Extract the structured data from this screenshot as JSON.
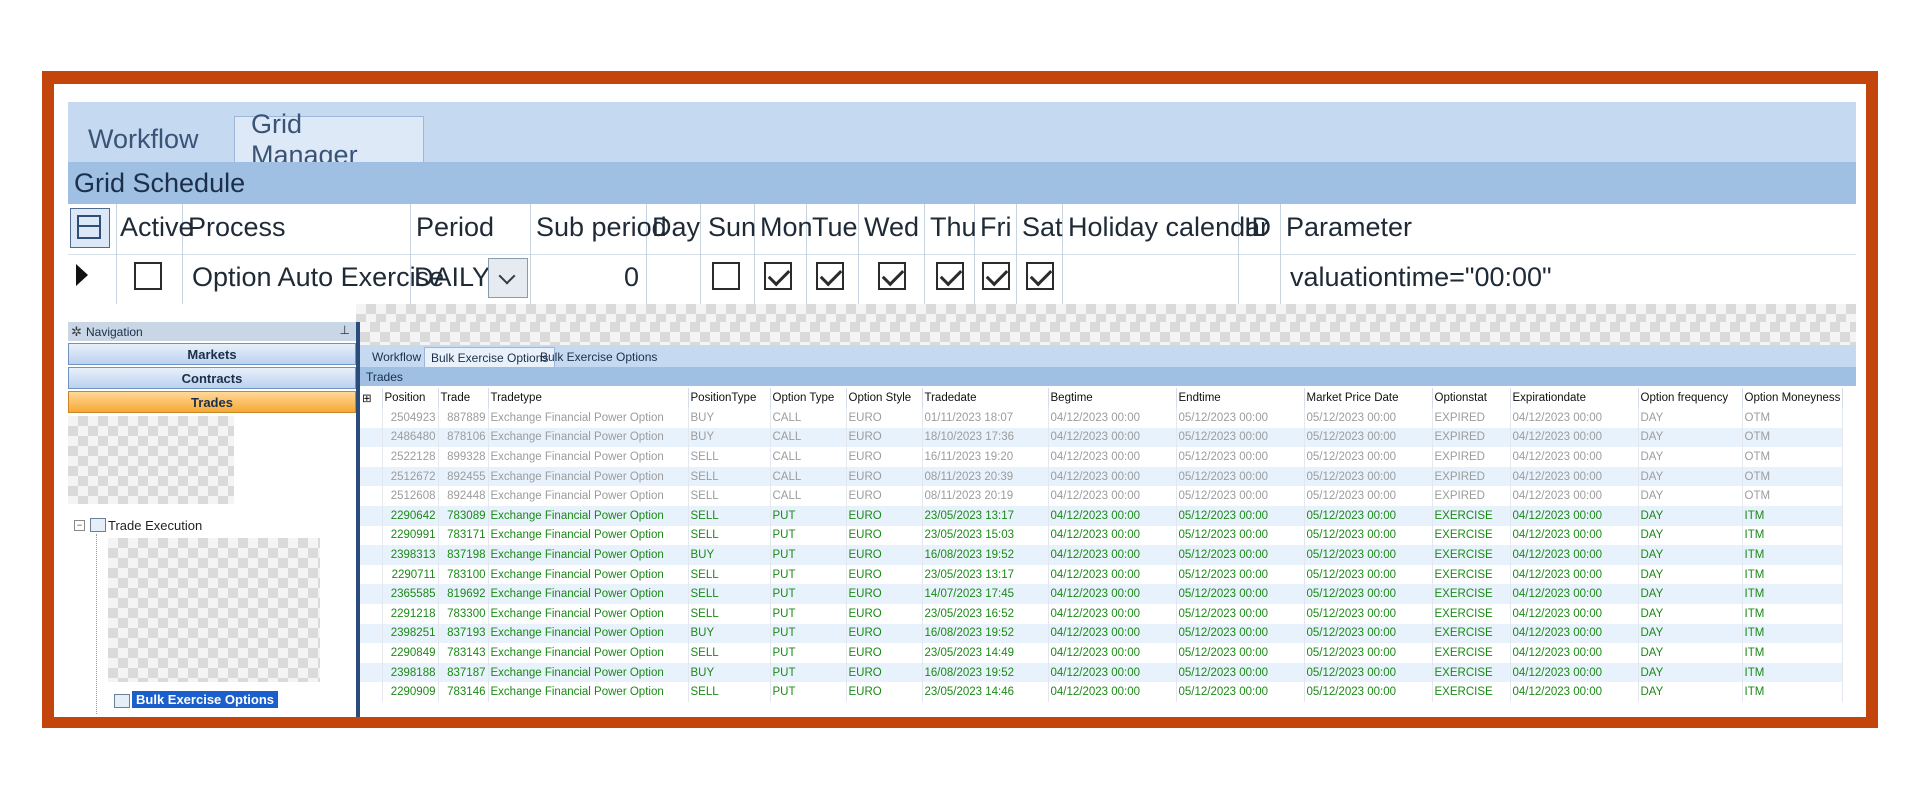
{
  "top_tabs": [
    "Workflow",
    "Grid Manager"
  ],
  "section_title": "Grid Schedule",
  "schedule": {
    "columns": [
      "Active",
      "Process",
      "Period",
      "Sub period",
      "Day",
      "Sun",
      "Mon",
      "Tue",
      "Wed",
      "Thu",
      "Fri",
      "Sat",
      "Holiday calendar",
      "ID",
      "Parameter"
    ],
    "row": {
      "active": false,
      "process": "Option Auto Exercise",
      "period": "DAILY",
      "sub_period": "0",
      "day": "",
      "sun": false,
      "mon": true,
      "tue": true,
      "wed": true,
      "thu": true,
      "fri": true,
      "sat": true,
      "holiday_calendar": "",
      "id": "",
      "parameter": "valuationtime=\"00:00\""
    }
  },
  "navigation": {
    "title": "Navigation",
    "buttons": [
      "Markets",
      "Contracts",
      "Trades"
    ],
    "tree_node": "Trade Execution",
    "selected_node": "Bulk Exercise Options"
  },
  "trades_tabs": [
    "Workflow",
    "Bulk Exercise Options",
    "Bulk Exercise Options"
  ],
  "trades_title": "Trades",
  "trade_columns": [
    "Position",
    "Trade",
    "Tradetype",
    "PositionType",
    "Option Type",
    "Option Style",
    "Tradedate",
    "Begtime",
    "Endtime",
    "Market Price Date",
    "Optionstat",
    "Expirationdate",
    "Option frequency",
    "Option Moneyness"
  ],
  "trades": [
    {
      "status_group": "expired",
      "cells": [
        "2504923",
        "887889",
        "Exchange Financial Power Option",
        "BUY",
        "CALL",
        "EURO",
        "01/11/2023 18:07",
        "04/12/2023 00:00",
        "05/12/2023 00:00",
        "05/12/2023 00:00",
        "EXPIRED",
        "04/12/2023 00:00",
        "DAY",
        "OTM"
      ]
    },
    {
      "status_group": "expired",
      "cells": [
        "2486480",
        "878106",
        "Exchange Financial Power Option",
        "BUY",
        "CALL",
        "EURO",
        "18/10/2023 17:36",
        "04/12/2023 00:00",
        "05/12/2023 00:00",
        "05/12/2023 00:00",
        "EXPIRED",
        "04/12/2023 00:00",
        "DAY",
        "OTM"
      ]
    },
    {
      "status_group": "expired",
      "cells": [
        "2522128",
        "899328",
        "Exchange Financial Power Option",
        "SELL",
        "CALL",
        "EURO",
        "16/11/2023 19:20",
        "04/12/2023 00:00",
        "05/12/2023 00:00",
        "05/12/2023 00:00",
        "EXPIRED",
        "04/12/2023 00:00",
        "DAY",
        "OTM"
      ]
    },
    {
      "status_group": "expired",
      "cells": [
        "2512672",
        "892455",
        "Exchange Financial Power Option",
        "SELL",
        "CALL",
        "EURO",
        "08/11/2023 20:39",
        "04/12/2023 00:00",
        "05/12/2023 00:00",
        "05/12/2023 00:00",
        "EXPIRED",
        "04/12/2023 00:00",
        "DAY",
        "OTM"
      ]
    },
    {
      "status_group": "expired",
      "cells": [
        "2512608",
        "892448",
        "Exchange Financial Power Option",
        "SELL",
        "CALL",
        "EURO",
        "08/11/2023 20:19",
        "04/12/2023 00:00",
        "05/12/2023 00:00",
        "05/12/2023 00:00",
        "EXPIRED",
        "04/12/2023 00:00",
        "DAY",
        "OTM"
      ]
    },
    {
      "status_group": "exercise",
      "cells": [
        "2290642",
        "783089",
        "Exchange Financial Power Option",
        "SELL",
        "PUT",
        "EURO",
        "23/05/2023 13:17",
        "04/12/2023 00:00",
        "05/12/2023 00:00",
        "05/12/2023 00:00",
        "EXERCISE",
        "04/12/2023 00:00",
        "DAY",
        "ITM"
      ]
    },
    {
      "status_group": "exercise",
      "cells": [
        "2290991",
        "783171",
        "Exchange Financial Power Option",
        "SELL",
        "PUT",
        "EURO",
        "23/05/2023 15:03",
        "04/12/2023 00:00",
        "05/12/2023 00:00",
        "05/12/2023 00:00",
        "EXERCISE",
        "04/12/2023 00:00",
        "DAY",
        "ITM"
      ]
    },
    {
      "status_group": "exercise",
      "cells": [
        "2398313",
        "837198",
        "Exchange Financial Power Option",
        "BUY",
        "PUT",
        "EURO",
        "16/08/2023 19:52",
        "04/12/2023 00:00",
        "05/12/2023 00:00",
        "05/12/2023 00:00",
        "EXERCISE",
        "04/12/2023 00:00",
        "DAY",
        "ITM"
      ]
    },
    {
      "status_group": "exercise",
      "cells": [
        "2290711",
        "783100",
        "Exchange Financial Power Option",
        "SELL",
        "PUT",
        "EURO",
        "23/05/2023 13:17",
        "04/12/2023 00:00",
        "05/12/2023 00:00",
        "05/12/2023 00:00",
        "EXERCISE",
        "04/12/2023 00:00",
        "DAY",
        "ITM"
      ]
    },
    {
      "status_group": "exercise",
      "cells": [
        "2365585",
        "819692",
        "Exchange Financial Power Option",
        "SELL",
        "PUT",
        "EURO",
        "14/07/2023 17:45",
        "04/12/2023 00:00",
        "05/12/2023 00:00",
        "05/12/2023 00:00",
        "EXERCISE",
        "04/12/2023 00:00",
        "DAY",
        "ITM"
      ]
    },
    {
      "status_group": "exercise",
      "cells": [
        "2291218",
        "783300",
        "Exchange Financial Power Option",
        "SELL",
        "PUT",
        "EURO",
        "23/05/2023 16:52",
        "04/12/2023 00:00",
        "05/12/2023 00:00",
        "05/12/2023 00:00",
        "EXERCISE",
        "04/12/2023 00:00",
        "DAY",
        "ITM"
      ]
    },
    {
      "status_group": "exercise",
      "cells": [
        "2398251",
        "837193",
        "Exchange Financial Power Option",
        "BUY",
        "PUT",
        "EURO",
        "16/08/2023 19:52",
        "04/12/2023 00:00",
        "05/12/2023 00:00",
        "05/12/2023 00:00",
        "EXERCISE",
        "04/12/2023 00:00",
        "DAY",
        "ITM"
      ]
    },
    {
      "status_group": "exercise",
      "cells": [
        "2290849",
        "783143",
        "Exchange Financial Power Option",
        "SELL",
        "PUT",
        "EURO",
        "23/05/2023 14:49",
        "04/12/2023 00:00",
        "05/12/2023 00:00",
        "05/12/2023 00:00",
        "EXERCISE",
        "04/12/2023 00:00",
        "DAY",
        "ITM"
      ]
    },
    {
      "status_group": "exercise",
      "cells": [
        "2398188",
        "837187",
        "Exchange Financial Power Option",
        "BUY",
        "PUT",
        "EURO",
        "16/08/2023 19:52",
        "04/12/2023 00:00",
        "05/12/2023 00:00",
        "05/12/2023 00:00",
        "EXERCISE",
        "04/12/2023 00:00",
        "DAY",
        "ITM"
      ]
    },
    {
      "status_group": "exercise",
      "cells": [
        "2290909",
        "783146",
        "Exchange Financial Power Option",
        "SELL",
        "PUT",
        "EURO",
        "23/05/2023 14:46",
        "04/12/2023 00:00",
        "05/12/2023 00:00",
        "05/12/2023 00:00",
        "EXERCISE",
        "04/12/2023 00:00",
        "DAY",
        "ITM"
      ]
    }
  ],
  "colors": {
    "frame": "#c4450c",
    "expired_text": "#9c9c9c",
    "exercise_text": "#1a8a16",
    "selected_nav": "#f7a934"
  }
}
